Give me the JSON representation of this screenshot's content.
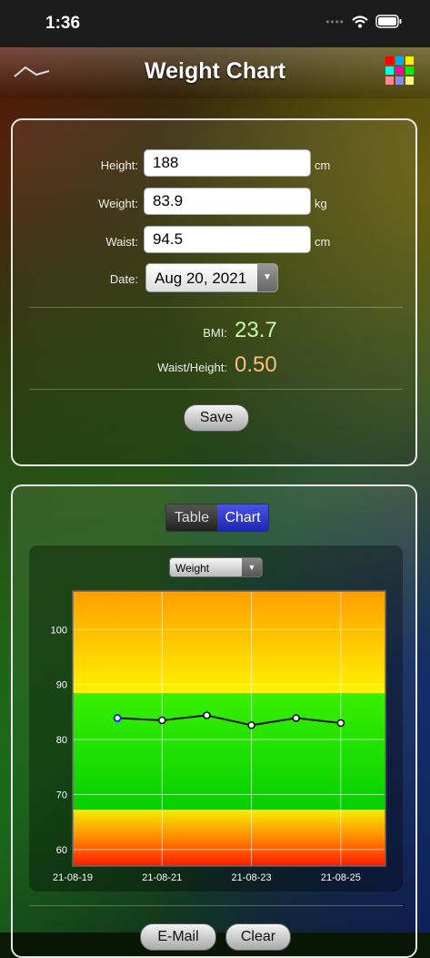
{
  "status": {
    "time": "1:36"
  },
  "nav": {
    "title": "Weight Chart",
    "grid_colors": [
      "#ff0000",
      "#00aaff",
      "#ffee00",
      "#00ffee",
      "#ff00aa",
      "#00ee00",
      "#ff8888",
      "#8888ff",
      "#ffff88"
    ]
  },
  "form": {
    "height": {
      "label": "Height:",
      "value": "188",
      "unit": "cm"
    },
    "weight": {
      "label": "Weight:",
      "value": "83.9",
      "unit": "kg"
    },
    "waist": {
      "label": "Waist:",
      "value": "94.5",
      "unit": "cm"
    },
    "date": {
      "label": "Date:",
      "value": "Aug 20, 2021"
    }
  },
  "results": {
    "bmi_label": "BMI:",
    "bmi_value": "23.7",
    "wh_label": "Waist/Height:",
    "wh_value": "0.50"
  },
  "buttons": {
    "save": "Save",
    "email": "E-Mail",
    "clear": "Clear"
  },
  "segment": {
    "table": "Table",
    "chart": "Chart",
    "selected": "Chart"
  },
  "series_select": {
    "value": "Weight"
  },
  "chart_data": {
    "type": "line",
    "x": [
      "21-08-20",
      "21-08-21",
      "21-08-22",
      "21-08-23",
      "21-08-24",
      "21-08-25"
    ],
    "series": [
      {
        "values": [
          83.9,
          83.5,
          84.4,
          82.6,
          83.9,
          83.0
        ]
      }
    ],
    "x_tick_labels": [
      "21-08-19",
      "21-08-21",
      "21-08-23",
      "21-08-25"
    ],
    "y_tick_labels": [
      "60",
      "70",
      "80",
      "90",
      "100"
    ],
    "ylim": [
      57,
      107
    ],
    "grid": true,
    "bands": [
      {
        "from": 57,
        "to": 67.3,
        "color": "red-yellow"
      },
      {
        "from": 67.3,
        "to": 88.4,
        "color": "green"
      },
      {
        "from": 88.4,
        "to": 107,
        "color": "yellow-orange"
      }
    ]
  }
}
